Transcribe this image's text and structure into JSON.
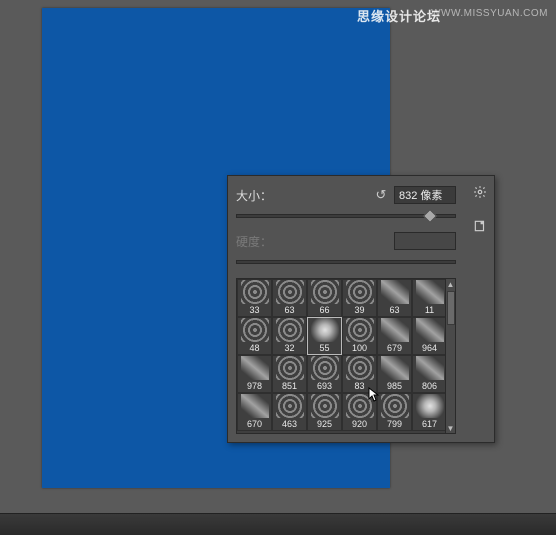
{
  "watermark": {
    "cn": "思缘设计论坛",
    "en": "WWW.MISSYUAN.COM"
  },
  "popup": {
    "size_label": "大小：",
    "size_value": "832 像素",
    "size_slider_percent": 88,
    "hardness_label": "硬度：",
    "hardness_value": "",
    "reset_icon": "↺"
  },
  "icons": {
    "gear": "gear-icon",
    "newdoc": "new-preset-icon"
  },
  "brush_grid": {
    "rows": [
      [
        {
          "s": "33",
          "v": "scatter"
        },
        {
          "s": "63",
          "v": "scatter"
        },
        {
          "s": "66",
          "v": "scatter"
        },
        {
          "s": "39",
          "v": "scatter"
        },
        {
          "s": "63",
          "v": "streak"
        },
        {
          "s": "11",
          "v": "streak"
        }
      ],
      [
        {
          "s": "48",
          "v": "scatter"
        },
        {
          "s": "32",
          "v": "scatter"
        },
        {
          "s": "55",
          "v": "soft",
          "sel": true
        },
        {
          "s": "100",
          "v": "scatter"
        },
        {
          "s": "679",
          "v": "streak"
        },
        {
          "s": "964",
          "v": "streak"
        }
      ],
      [
        {
          "s": "978",
          "v": "streak"
        },
        {
          "s": "851",
          "v": "scatter"
        },
        {
          "s": "693",
          "v": "scatter"
        },
        {
          "s": "83",
          "v": "scatter"
        },
        {
          "s": "985",
          "v": "streak"
        },
        {
          "s": "806",
          "v": "streak"
        }
      ],
      [
        {
          "s": "670",
          "v": "streak"
        },
        {
          "s": "463",
          "v": "scatter"
        },
        {
          "s": "925",
          "v": "scatter"
        },
        {
          "s": "920",
          "v": "scatter"
        },
        {
          "s": "799",
          "v": "scatter"
        },
        {
          "s": "617",
          "v": "soft"
        }
      ]
    ]
  }
}
